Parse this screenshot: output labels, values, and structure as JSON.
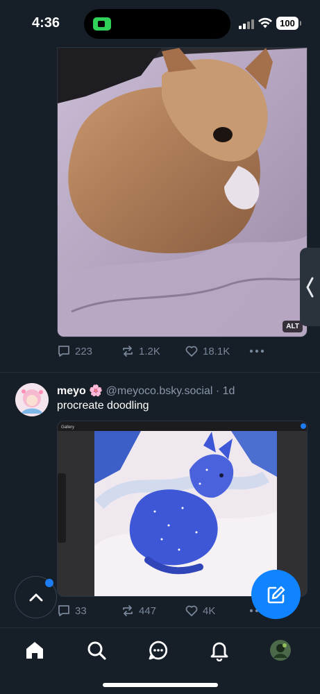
{
  "status_bar": {
    "time": "4:36",
    "battery": "100"
  },
  "post1": {
    "image_alt_badge": "ALT",
    "replies": "223",
    "reposts": "1.2K",
    "likes": "18.1K"
  },
  "post2": {
    "author_name": "meyo 🌸",
    "handle": "@meyoco.bsky.social",
    "separator": "·",
    "age": "1d",
    "text": "procreate doodling",
    "image_toolbar_label": "Gallery",
    "replies": "33",
    "reposts": "447",
    "likes": "4K"
  },
  "colors": {
    "background": "#161e27",
    "accent": "#1083fe",
    "muted": "#78879a"
  },
  "icons": {
    "nav": [
      "home-icon",
      "search-icon",
      "chat-icon",
      "bell-icon",
      "profile-avatar"
    ],
    "actions": [
      "reply-icon",
      "repost-icon",
      "like-icon",
      "more-icon"
    ]
  }
}
